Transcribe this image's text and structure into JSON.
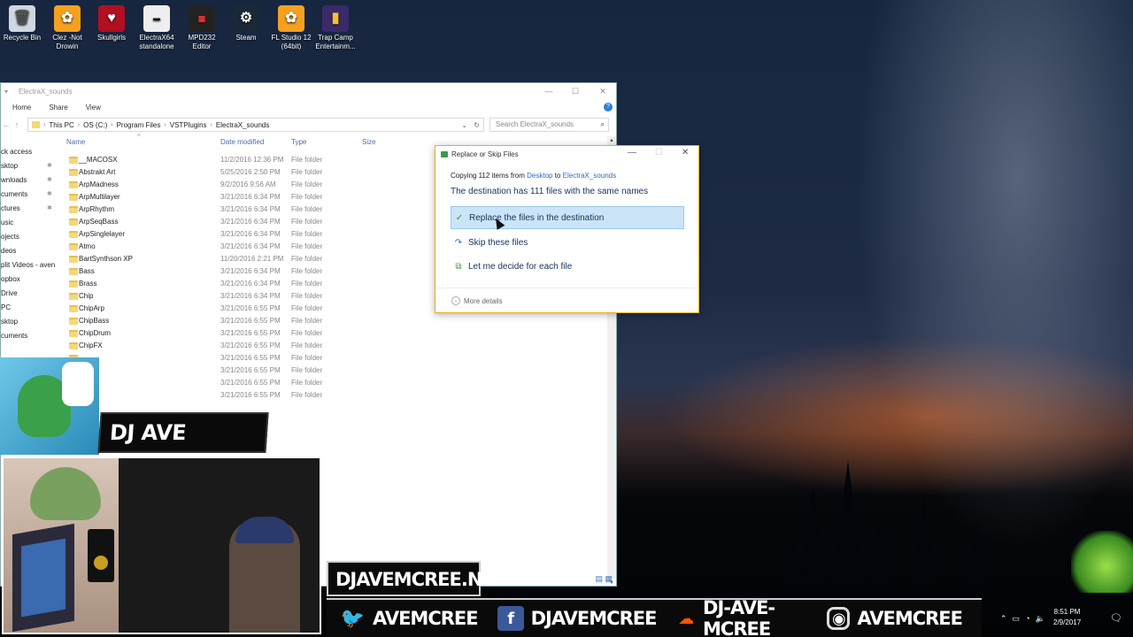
{
  "desktop": {
    "icons": [
      {
        "label": "Recycle Bin",
        "icon": "recycle-bin-icon"
      },
      {
        "label": "Clez -Not Drowin",
        "icon": "fl-studio-icon"
      },
      {
        "label": "Skullgirls",
        "icon": "skullgirls-icon"
      },
      {
        "label": "ElectraX64 standalone",
        "icon": "electrax-icon"
      },
      {
        "label": "MPD232 Editor",
        "icon": "mpd232-icon"
      },
      {
        "label": "Steam",
        "icon": "steam-icon"
      },
      {
        "label": "FL Studio 12 (64bit)",
        "icon": "fl-studio-icon"
      },
      {
        "label": "Trap Camp Entertainm...",
        "icon": "book-icon"
      }
    ]
  },
  "explorer": {
    "title": "ElectraX_sounds",
    "ribbon_tabs": [
      "Home",
      "Share",
      "View"
    ],
    "breadcrumb": [
      "This PC",
      "OS (C:)",
      "Program Files",
      "VSTPlugins",
      "ElectraX_sounds"
    ],
    "search_placeholder": "Search ElectraX_sounds",
    "columns": {
      "name": "Name",
      "date": "Date modified",
      "type": "Type",
      "size": "Size"
    },
    "nav_items": [
      {
        "label": "ck access",
        "pinned": false
      },
      {
        "label": "sktop",
        "pinned": true
      },
      {
        "label": "wnloads",
        "pinned": true
      },
      {
        "label": "cuments",
        "pinned": true
      },
      {
        "label": "ctures",
        "pinned": true
      },
      {
        "label": "usic",
        "pinned": false
      },
      {
        "label": "ojects",
        "pinned": false
      },
      {
        "label": "deos",
        "pinned": false
      },
      {
        "label": "plit Videos - aven",
        "pinned": false
      },
      {
        "label": "opbox",
        "pinned": false
      },
      {
        "label": "Drive",
        "pinned": false
      },
      {
        "label": "PC",
        "pinned": false
      },
      {
        "label": "sktop",
        "pinned": false
      },
      {
        "label": "cuments",
        "pinned": false
      }
    ],
    "files": [
      {
        "name": "__MACOSX",
        "date": "11/2/2016 12:36 PM",
        "type": "File folder"
      },
      {
        "name": "Abstrakt Art",
        "date": "5/25/2016 2:50 PM",
        "type": "File folder"
      },
      {
        "name": "ArpMadness",
        "date": "9/2/2016 9:56 AM",
        "type": "File folder"
      },
      {
        "name": "ArpMultilayer",
        "date": "3/21/2016 6:34 PM",
        "type": "File folder"
      },
      {
        "name": "ArpRhythm",
        "date": "3/21/2016 6:34 PM",
        "type": "File folder"
      },
      {
        "name": "ArpSeqBass",
        "date": "3/21/2016 6:34 PM",
        "type": "File folder"
      },
      {
        "name": "ArpSinglelayer",
        "date": "3/21/2016 6:34 PM",
        "type": "File folder"
      },
      {
        "name": "Atmo",
        "date": "3/21/2016 6:34 PM",
        "type": "File folder"
      },
      {
        "name": "BartSynthson XP",
        "date": "11/20/2016 2:21 PM",
        "type": "File folder"
      },
      {
        "name": "Bass",
        "date": "3/21/2016 6:34 PM",
        "type": "File folder"
      },
      {
        "name": "Brass",
        "date": "3/21/2016 6:34 PM",
        "type": "File folder"
      },
      {
        "name": "Chip",
        "date": "3/21/2016 6:34 PM",
        "type": "File folder"
      },
      {
        "name": "ChipArp",
        "date": "3/21/2016 6:55 PM",
        "type": "File folder"
      },
      {
        "name": "ChipBass",
        "date": "3/21/2016 6:55 PM",
        "type": "File folder"
      },
      {
        "name": "ChipDrum",
        "date": "3/21/2016 6:55 PM",
        "type": "File folder"
      },
      {
        "name": "ChipFX",
        "date": "3/21/2016 6:55 PM",
        "type": "File folder"
      },
      {
        "name": "",
        "date": "3/21/2016 6:55 PM",
        "type": "File folder"
      },
      {
        "name": "",
        "date": "3/21/2016 6:55 PM",
        "type": "File folder"
      },
      {
        "name": "",
        "date": "3/21/2016 6:55 PM",
        "type": "File folder"
      },
      {
        "name": "",
        "date": "3/21/2016 6:55 PM",
        "type": "File folder"
      }
    ]
  },
  "dialog": {
    "title": "Replace or Skip Files",
    "copying_prefix": "Copying 112 items from",
    "source": "Desktop",
    "to_word": "to",
    "destination": "ElectraX_sounds",
    "heading": "The destination has 111 files with the same names",
    "options": [
      {
        "label": "Replace the files in the destination",
        "icon": "checkmark-icon",
        "selected": true
      },
      {
        "label": "Skip these files",
        "icon": "skip-icon",
        "selected": false
      },
      {
        "label": "Let me decide for each file",
        "icon": "compare-icon",
        "selected": false
      }
    ],
    "more_details": "More details"
  },
  "overlay": {
    "name_banner": "DJ AVE MCREE",
    "site": "DJAVEMCREE.NET",
    "socials": [
      {
        "handle": "AVEMCREE",
        "icon": "twitter-icon"
      },
      {
        "handle": "DJAVEMCREE",
        "icon": "facebook-icon"
      },
      {
        "handle": "DJ-AVE-MCREE",
        "icon": "soundcloud-icon"
      },
      {
        "handle": "AVEMCREE",
        "icon": "instagram-icon"
      }
    ]
  },
  "taskbar": {
    "time": "8:51 PM",
    "date": "2/9/2017"
  }
}
